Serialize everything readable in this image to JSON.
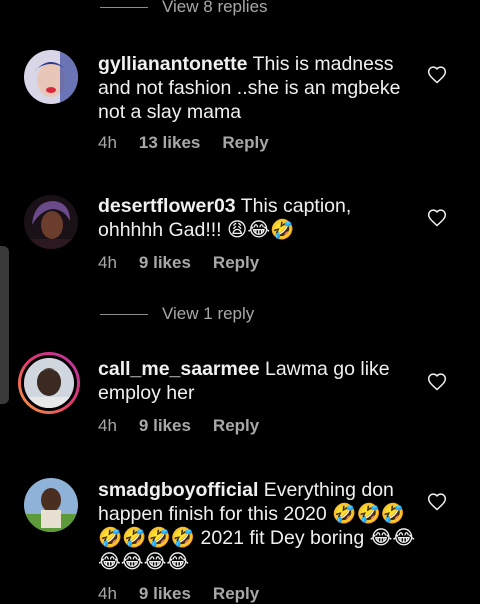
{
  "replies_top": "View 8 replies",
  "replies_mid": "View 1 reply",
  "comments": [
    {
      "user": "gyllianantonette",
      "text": "This is madness and not fashion ..she is an mgbeke not a slay mama",
      "time": "4h",
      "likes": "13 likes",
      "reply": "Reply"
    },
    {
      "user": "desertflower03",
      "text": "This caption, ohhhhh Gad!!! 😩😂🤣",
      "time": "4h",
      "likes": "9 likes",
      "reply": "Reply"
    },
    {
      "user": "call_me_saarmee",
      "text": "Lawma go like employ her",
      "time": "4h",
      "likes": "9 likes",
      "reply": "Reply"
    },
    {
      "user": "smadgboyofficial",
      "text": "Everything don happen finish for this 2020 🤣🤣🤣🤣🤣🤣🤣 2021 fit Dey boring 😂😂😂😂😂😂",
      "time": "4h",
      "likes": "9 likes",
      "reply": "Reply"
    }
  ],
  "colors": {
    "background": "#000000",
    "text": "#f0f0f0",
    "muted": "#a8a8a8"
  }
}
